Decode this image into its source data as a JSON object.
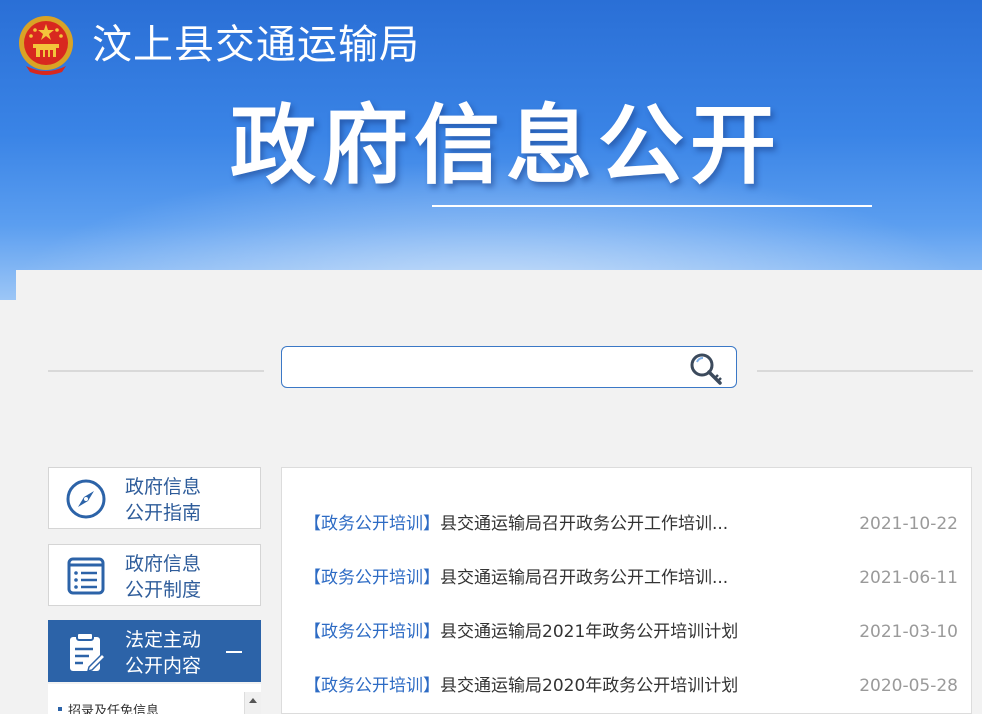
{
  "header": {
    "site_name": "汶上县交通运输局",
    "banner_title": "政府信息公开"
  },
  "search": {
    "placeholder": "",
    "value": ""
  },
  "sidebar": {
    "items": [
      {
        "line1": "政府信息",
        "line2": "公开指南",
        "icon": "compass-icon"
      },
      {
        "line1": "政府信息",
        "line2": "公开制度",
        "icon": "list-document-icon"
      },
      {
        "line1": "法定主动",
        "line2": "公开内容",
        "icon": "clipboard-edit-icon",
        "active": true
      }
    ],
    "sub_items": [
      "招录及任免信息"
    ]
  },
  "news": [
    {
      "category": "【政务公开培训】",
      "title": "县交通运输局召开政务公开工作培训...",
      "date": "2021-10-22"
    },
    {
      "category": "【政务公开培训】",
      "title": "县交通运输局召开政务公开工作培训...",
      "date": "2021-06-11"
    },
    {
      "category": "【政务公开培训】",
      "title": "县交通运输局2021年政务公开培训计划",
      "date": "2021-03-10"
    },
    {
      "category": "【政务公开培训】",
      "title": "县交通运输局2020年政务公开培训计划",
      "date": "2020-05-28"
    }
  ],
  "colors": {
    "header_blue": "#2a6fd6",
    "accent_blue": "#2c63a8",
    "category_blue": "#2d6bc4",
    "date_gray": "#9a9a9a"
  }
}
